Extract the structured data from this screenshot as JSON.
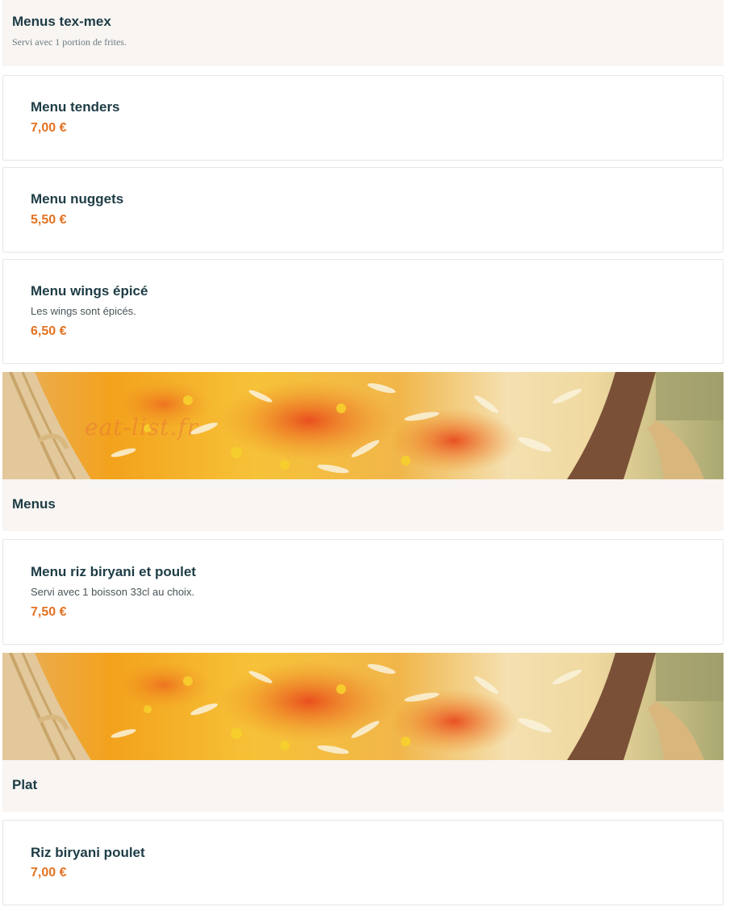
{
  "sections": [
    {
      "title": "Menus tex-mex",
      "subtitle": "Servi avec 1 portion de frites.",
      "items": [
        {
          "name": "Menu tenders",
          "description": "",
          "price": "7,00 €"
        },
        {
          "name": "Menu nuggets",
          "description": "",
          "price": "5,50 €"
        },
        {
          "name": "Menu wings épicé",
          "description": "Les wings sont épicés.",
          "price": "6,50 €"
        }
      ]
    },
    {
      "title": "Menus",
      "subtitle": "",
      "banner_watermark": "eat-list.fr",
      "items": [
        {
          "name": "Menu riz biryani et poulet",
          "description": "Servi avec 1 boisson 33cl au choix.",
          "price": "7,50 €"
        }
      ]
    },
    {
      "title": "Plat",
      "subtitle": "",
      "items": [
        {
          "name": "Riz biryani poulet",
          "description": "",
          "price": "7,00 €"
        }
      ]
    }
  ],
  "colors": {
    "title": "#1d3c45",
    "price": "#e37222",
    "header_bg": "#f8f5f2"
  }
}
